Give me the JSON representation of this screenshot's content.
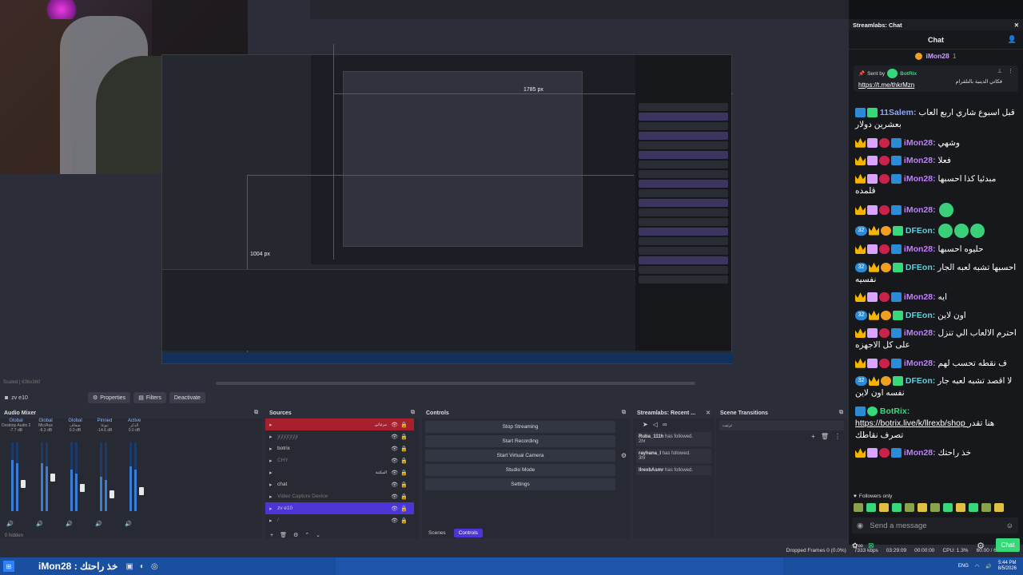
{
  "window": {
    "controls": [
      "—",
      "▢",
      "✕"
    ]
  },
  "preview": {
    "nested_labels": {
      "width_px": "1785 px",
      "height_px": "1004 px"
    },
    "status_mini": "Scaled | 636x360"
  },
  "source_toolbar": {
    "source_name": "zv e10",
    "properties_label": "Properties",
    "filters_label": "Filters",
    "deactivate_label": "Deactivate"
  },
  "audio_mixer": {
    "title": "Audio Mixer",
    "hidden_label": "0 hidden",
    "columns": [
      {
        "header": "Global",
        "name": "Desktop Audio 2",
        "db": "-7.7 dB",
        "level": 0.75,
        "knob": 0.45
      },
      {
        "header": "Global",
        "name": "Mic/Aux",
        "db": "-8.3 dB",
        "level": 0.7,
        "knob": 0.55
      },
      {
        "header": "Global",
        "name": "ضفاف",
        "db": "0.0 dB",
        "level": 0.6,
        "knob": 0.4
      },
      {
        "header": "Pinned",
        "name": "تبوغا",
        "db": "-14.6 dB",
        "level": 0.5,
        "knob": 0.3
      },
      {
        "header": "Active",
        "name": "الذكر",
        "db": "0.0 dB",
        "level": 0.65,
        "knob": 0.35
      }
    ]
  },
  "sources": {
    "title": "Sources",
    "items": [
      {
        "label": "",
        "rtl": "مرئياتي",
        "style": "red"
      },
      {
        "label": "ﻹﻹﻹﻹﻹﻹﻹ",
        "rtl": "",
        "style": "dim"
      },
      {
        "label": "botrix",
        "rtl": "",
        "style": ""
      },
      {
        "label": "CHY",
        "rtl": "",
        "style": "dim"
      },
      {
        "label": "",
        "rtl": "المكتبة",
        "style": ""
      },
      {
        "label": "chat",
        "rtl": "",
        "style": ""
      },
      {
        "label": "Video Capture Device",
        "rtl": "",
        "style": "dim"
      },
      {
        "label": "zv e10",
        "rtl": "",
        "style": "sel"
      },
      {
        "label": "/",
        "rtl": "",
        "style": "dim"
      }
    ]
  },
  "controls": {
    "title": "Controls",
    "buttons": [
      "Stop Streaming",
      "Start Recording",
      "Start Virtual Camera",
      "Studio Mode",
      "Settings"
    ],
    "tabs": [
      "Scenes",
      "Controls"
    ]
  },
  "recent_events": {
    "title": "Streamlabs: Recent ...",
    "events": [
      {
        "name": "Ruba_111h",
        "action": "has followed.",
        "time": "2hr"
      },
      {
        "name": "rayhana_l",
        "action": "has followed.",
        "time": "3hr"
      },
      {
        "name": "llrexbAsmr",
        "action": "has followed.",
        "time": ""
      }
    ]
  },
  "scene_transitions": {
    "title": "Scene Transitions",
    "selected": "ترتيب"
  },
  "obs_status": {
    "dropped": "Dropped Frames 0 (0.0%)",
    "bitrate": "7333 kbps",
    "stream_time": "03:29:09",
    "rec_time": "00:00:00",
    "cpu": "CPU: 1.3%",
    "fps": "60.00 / 60.00 FPS"
  },
  "taskbar": {
    "ticker_user": "iMon28",
    "ticker_text": ": خذ راحتك",
    "lang": "ENG",
    "time": "5:44 PM",
    "date": "8/5/2026"
  },
  "chat": {
    "panel_title": "Streamlabs: Chat",
    "header": "Chat",
    "current_user": "iMon28",
    "current_user_sub": "1",
    "pinned": {
      "sent_by_label": "Sent by",
      "sent_by_user": "BotRix",
      "link": "https://t.me/thkrMzn",
      "rtl_text": "فكاتي الدينية بالتلقرام"
    },
    "messages": [
      {
        "badges": [
          "sword",
          "bars"
        ],
        "user": "11Salem",
        "color": "blue",
        "text": "قبل اسبوع شاري اربع العاب بعشرين دولار"
      },
      {
        "badges": [
          "crown",
          "cake",
          "pill",
          "sword"
        ],
        "user": "iMon28",
        "color": "purple",
        "text": "وشهي"
      },
      {
        "badges": [
          "crown",
          "cake",
          "pill",
          "sword"
        ],
        "user": "iMon28",
        "color": "purple",
        "text": "فعلا"
      },
      {
        "badges": [
          "crown",
          "cake",
          "pill",
          "sword"
        ],
        "user": "iMon28",
        "color": "purple",
        "text": "مبدئيا كذا احسبها قلمده"
      },
      {
        "badges": [
          "crown",
          "cake",
          "pill",
          "sword"
        ],
        "user": "iMon28",
        "color": "purple",
        "text": "",
        "emotes": 1
      },
      {
        "badges": [
          "num32",
          "crown",
          "coin",
          "bars"
        ],
        "user": "DFEon",
        "color": "teal",
        "text": "",
        "emotes": 3
      },
      {
        "badges": [
          "crown",
          "cake",
          "pill",
          "sword"
        ],
        "user": "iMon28",
        "color": "purple",
        "text": "حليوه احسبها"
      },
      {
        "badges": [
          "num32",
          "crown",
          "coin",
          "bars"
        ],
        "user": "DFEon",
        "color": "teal",
        "text": "احسبها تشبه لعبه الجار نفسيه"
      },
      {
        "badges": [
          "crown",
          "cake",
          "pill",
          "sword"
        ],
        "user": "iMon28",
        "color": "purple",
        "text": "ايه"
      },
      {
        "badges": [
          "num32",
          "crown",
          "coin",
          "bars"
        ],
        "user": "DFEon",
        "color": "teal",
        "text": "اون لاين"
      },
      {
        "badges": [
          "crown",
          "cake",
          "pill",
          "sword"
        ],
        "user": "iMon28",
        "color": "purple",
        "text": "احترم الالعاب الي تنزل على كل الاجهزه"
      },
      {
        "badges": [
          "crown",
          "cake",
          "pill",
          "sword"
        ],
        "user": "iMon28",
        "color": "purple",
        "text": "ف نقطه تحسب لهم"
      },
      {
        "badges": [
          "num32",
          "crown",
          "coin",
          "bars"
        ],
        "user": "DFEon",
        "color": "teal",
        "text": "لا اقصد تشبه لعبه جار نفسه اون لاين"
      },
      {
        "badges": [
          "sword",
          "check"
        ],
        "user": "BotRix",
        "color": "green",
        "text": "هنا تقدر تصرف نقاطك",
        "link": "https://botrix.live/k/llrexb/shop"
      },
      {
        "badges": [
          "crown",
          "cake",
          "pill",
          "sword"
        ],
        "user": "iMon28",
        "color": "purple",
        "text": "خذ راحتك"
      }
    ],
    "followers_only": "Followers only",
    "send_placeholder": "Send a message",
    "chat_button": "Chat"
  }
}
